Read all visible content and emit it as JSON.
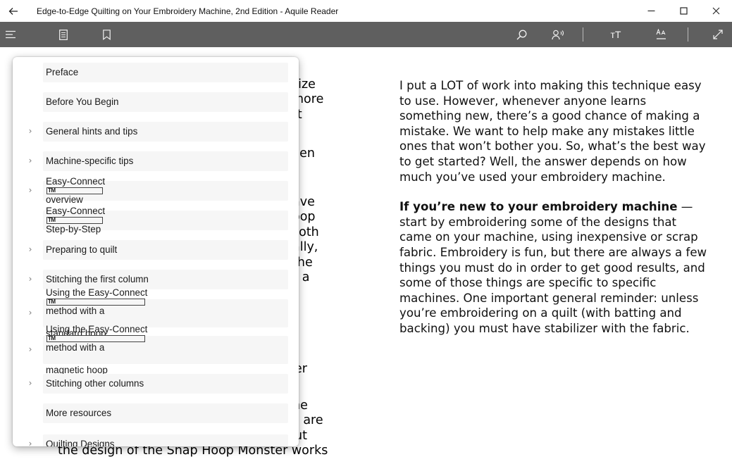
{
  "window": {
    "title": "Edge-to-Edge Quilting on Your Embroidery Machine, 2nd Edition - Aquile Reader",
    "back_icon": "arrow-left-icon",
    "controls": [
      "minimize-icon",
      "maximize-icon",
      "close-icon"
    ]
  },
  "toolbar": {
    "left_icons": [
      "hamburger-menu-icon",
      "document-list-icon",
      "bookmark-icon"
    ],
    "right_icons": [
      "search-icon",
      "read-aloud-icon",
      "font-size-icon",
      "text-style-icon",
      "fullscreen-icon"
    ],
    "font_size_label": "тT"
  },
  "toc": {
    "items": [
      {
        "label": "Preface",
        "expandable": false
      },
      {
        "label": "Before You Begin",
        "expandable": false
      },
      {
        "label": "General hints and tips",
        "expandable": true
      },
      {
        "label": "Machine-specific tips",
        "expandable": true
      },
      {
        "label": "Easy-Connect",
        "label_after": "overview",
        "expandable": true
      },
      {
        "label": "Easy-Connect",
        "label_after": "Step-by-Step",
        "expandable": false
      },
      {
        "label": "Preparing to quilt",
        "expandable": true
      },
      {
        "label": "Stitching the first column",
        "expandable": true
      },
      {
        "label": "Using the Easy-Connect",
        "label_after": "method with a",
        "label_line2": "standard hoop",
        "expandable": true
      },
      {
        "label": "Using the Easy-Connect",
        "label_after": "method with a",
        "label_line2": "magnetic hoop",
        "expandable": true
      },
      {
        "label": "Stitching other columns",
        "expandable": true
      },
      {
        "label": "More resources",
        "expandable": false
      },
      {
        "label": "Quilting Designs",
        "expandable": true
      }
    ],
    "tm_mark": "TM"
  },
  "left_page": {
    "fragments": [
      "size",
      "more",
      "it",
      "hen",
      "ave",
      "oop",
      "both",
      "ally,",
      "the",
      "f a",
      "er",
      "ne",
      "e are",
      "ut"
    ],
    "bottom_line": "the design of the Snap Hoop Monster works"
  },
  "right_page": {
    "paragraph1": "I put a LOT of work into making this technique easy to use. However, whenever anyone learns something new, there’s a good chance of making a mistake. We want to help make any mistakes little ones that won’t bother you. So, what’s the best way to get started? Well, the answer depends on how much you’ve used your embroidery machine.",
    "paragraph2_bold": "If you’re new to your embroidery machine",
    "paragraph2_rest": " — start by embroidering some of the designs that came on your machine, using inexpensive or scrap fabric. Embroidery is fun, but there are always a few things you must do in order to get good results, and some of those things are specific to specific machines. One important general reminder: unless you’re embroidering on a quilt (with batting and backing) you must have stabilizer with the fabric."
  }
}
